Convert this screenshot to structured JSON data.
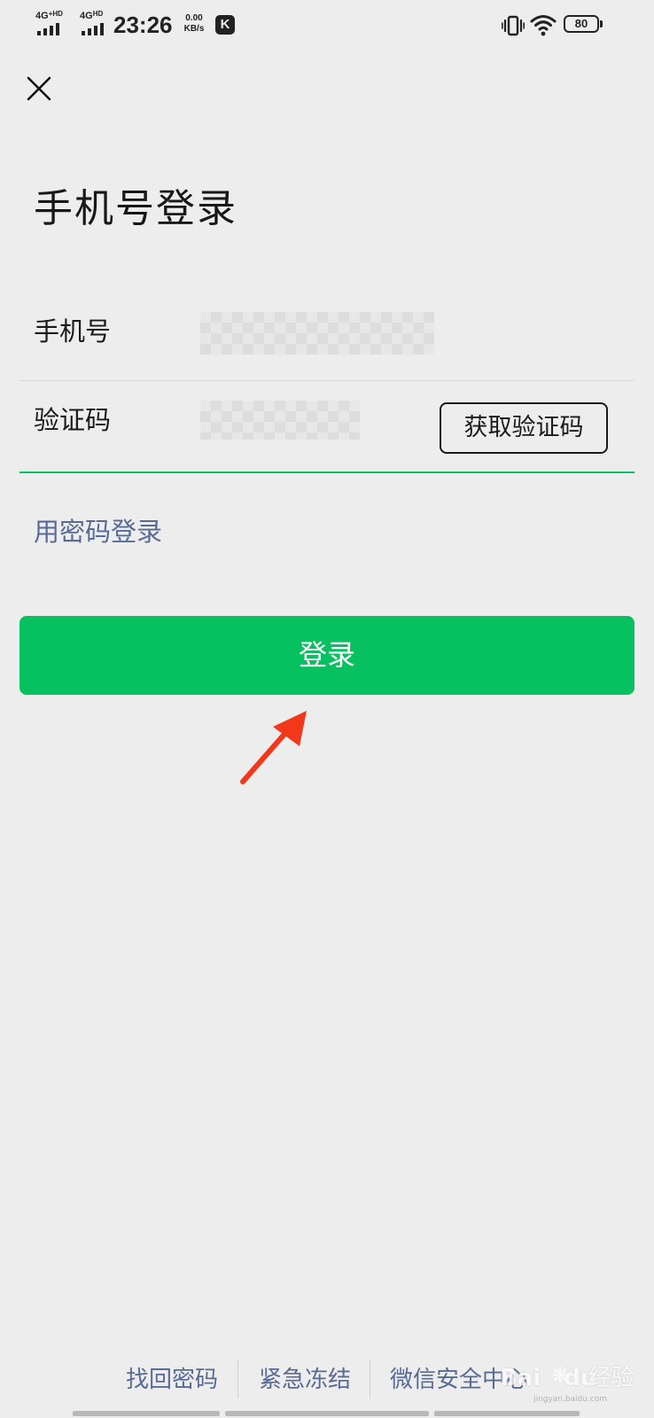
{
  "status_bar": {
    "sim1_label": "4G",
    "sim1_super": "+HD",
    "sim2_label": "4G",
    "sim2_super": "HD",
    "time": "23:26",
    "net_speed_value": "0.00",
    "net_speed_unit": "KB/s",
    "app_badge": "K",
    "battery_level": "80",
    "icons": [
      "signal-icon",
      "signal-icon",
      "k-app-icon",
      "vibrate-icon",
      "wifi-icon",
      "battery-icon"
    ]
  },
  "header": {
    "close_icon": "close-icon",
    "title": "手机号登录"
  },
  "form": {
    "phone_label": "手机号",
    "phone_value": "",
    "code_label": "验证码",
    "code_value": "",
    "get_code_button": "获取验证码",
    "accent_color": "#07c160"
  },
  "password_login_link": "用密码登录",
  "login_button": "登录",
  "annotation": {
    "arrow_color": "#f2381a"
  },
  "footer": {
    "links": [
      "找回密码",
      "紧急冻结",
      "微信安全中心"
    ],
    "link_color": "#576b95"
  },
  "watermark": {
    "brand": "Bai",
    "brand_suffix": "du",
    "brand_cn": "经验",
    "url": "jingyan.baidu.com"
  }
}
